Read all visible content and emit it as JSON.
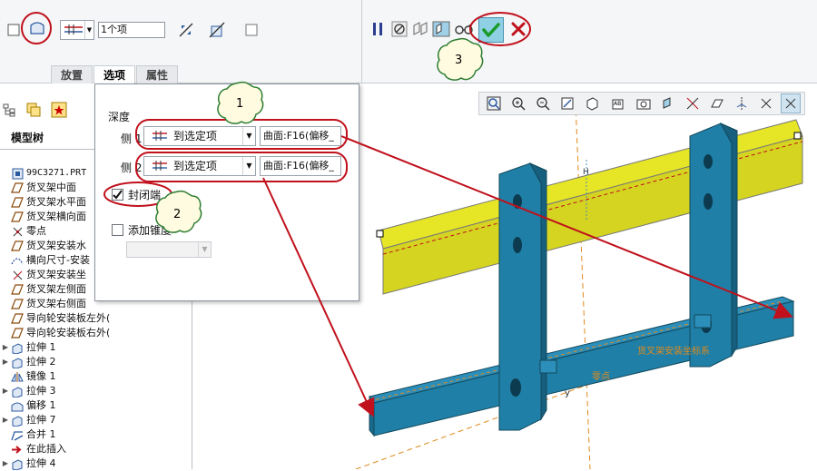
{
  "ribbon": {
    "count_value": "1个项",
    "tabs": [
      {
        "label": "放置"
      },
      {
        "label": "选项"
      },
      {
        "label": "属性"
      }
    ]
  },
  "tree": {
    "title": "模型树",
    "items": [
      {
        "label": "99C3271.PRT",
        "icon": "part-icon"
      },
      {
        "label": "货叉架中面",
        "icon": "datum-plane-icon"
      },
      {
        "label": "货叉架水平面",
        "icon": "datum-plane-icon"
      },
      {
        "label": "货叉架横向面",
        "icon": "datum-plane-icon"
      },
      {
        "label": "零点",
        "icon": "datum-point-icon"
      },
      {
        "label": "货叉架安装水",
        "icon": "datum-plane-icon"
      },
      {
        "label": "横向尺寸-安装",
        "icon": "datum-curve-icon"
      },
      {
        "label": "货叉架安装坐",
        "icon": "csys-icon"
      },
      {
        "label": "货叉架左侧面",
        "icon": "datum-plane-icon"
      },
      {
        "label": "货叉架右侧面",
        "icon": "datum-plane-icon"
      },
      {
        "label": "导向轮安装板左外(",
        "icon": "datum-plane-icon"
      },
      {
        "label": "导向轮安装板右外(",
        "icon": "datum-plane-icon"
      },
      {
        "label": "拉伸 1",
        "icon": "extrude-icon"
      },
      {
        "label": "拉伸 2",
        "icon": "extrude-icon"
      },
      {
        "label": "镜像 1",
        "icon": "mirror-icon"
      },
      {
        "label": "拉伸 3",
        "icon": "extrude-icon"
      },
      {
        "label": "偏移 1",
        "icon": "offset-icon"
      },
      {
        "label": "拉伸 7",
        "icon": "extrude-icon"
      },
      {
        "label": "合并 1",
        "icon": "merge-icon"
      },
      {
        "label": "在此插入",
        "icon": "insert-arrow-icon"
      },
      {
        "label": "拉伸 4",
        "icon": "extrude-icon"
      }
    ]
  },
  "options": {
    "depth_label": "深度",
    "side1_label": "侧 1",
    "side2_label": "侧 2",
    "side1_value": "到选定项",
    "side2_value": "到选定项",
    "side1_surface": "曲面:F16(偏移_",
    "side2_surface": "曲面:F16(偏移_",
    "capped_label": "封闭端",
    "capped_checked": true,
    "taper_label": "添加锥度",
    "taper_checked": false
  },
  "callouts": [
    {
      "number": "1"
    },
    {
      "number": "2"
    },
    {
      "number": "3"
    }
  ],
  "viewport": {
    "csys_label": "货叉架安装坐标系",
    "zero_label": "零点",
    "y_label": "y",
    "h_label": "H"
  },
  "colors": {
    "part_blue": "#1f7fa6",
    "rail_yellow": "#e6e627",
    "arrow_red": "#c0111c",
    "confirm_green": "#1a9a2a",
    "callout_fill": "#fffbe0"
  }
}
